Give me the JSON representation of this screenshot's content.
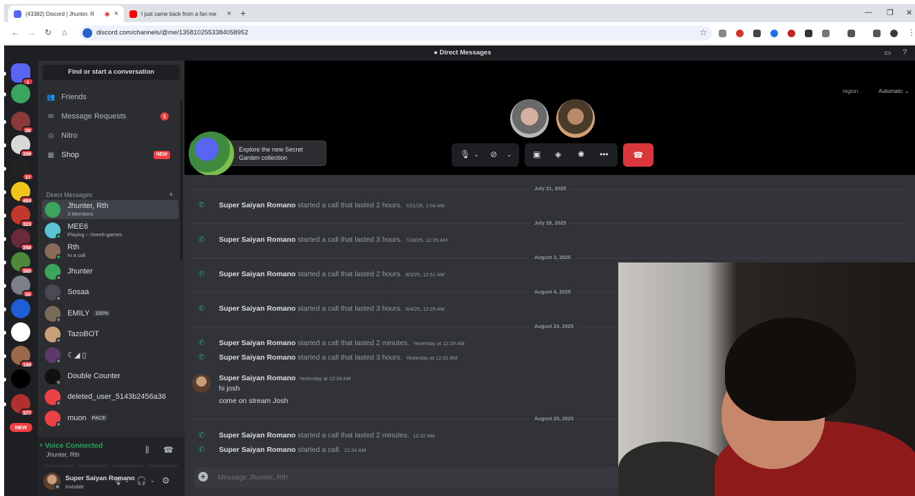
{
  "browser": {
    "tabs": [
      {
        "title": "(43382) Discord | Jhunter, R",
        "active": true,
        "color": "#5865f2"
      },
      {
        "title": "I just came back from a fan me",
        "active": false,
        "color": "#ff0000"
      }
    ],
    "url": "discord.com/channels/@me/1358102553384058952"
  },
  "app": {
    "title": "Direct Messages",
    "servers": [
      {
        "badge": "1",
        "color": "#5865f2"
      },
      {
        "badge": "",
        "color": "#3ba55d"
      },
      {
        "badge": "26",
        "color": "#8b3a3a"
      },
      {
        "badge": "208",
        "color": "#d8d8d8"
      },
      {
        "badge": "17",
        "color": "#222222"
      },
      {
        "badge": "450",
        "color": "#f0c419"
      },
      {
        "badge": "323",
        "color": "#c0392b"
      },
      {
        "badge": "258",
        "color": "#6b2a3a"
      },
      {
        "badge": "385",
        "color": "#4c8a3a"
      },
      {
        "badge": "56",
        "color": "#7a7f8a"
      },
      {
        "badge": "",
        "color": "#1e5fd6"
      },
      {
        "badge": "",
        "color": "#ffffff"
      },
      {
        "badge": "189",
        "color": "#9a6a4a"
      },
      {
        "badge": "",
        "color": "#000000"
      },
      {
        "badge": "377",
        "color": "#b03030"
      }
    ],
    "new_label": "NEW",
    "search_placeholder": "Find or start a conversation",
    "nav": [
      {
        "label": "Friends",
        "icon": "friends-icon"
      },
      {
        "label": "Message Requests",
        "icon": "mail-icon",
        "badge": "1"
      },
      {
        "label": "Nitro",
        "icon": "nitro-icon"
      },
      {
        "label": "Shop",
        "icon": "shop-icon",
        "tag": "NEW"
      }
    ],
    "dm_header": "Direct Messages",
    "dms": [
      {
        "name": "Jhunter, Rth",
        "sub": "3 Members",
        "color": "#3ba55d",
        "status": "",
        "selected": true
      },
      {
        "name": "MEE6",
        "sub": "Playing ⌐ /mee6-games",
        "color": "#5cc2d6",
        "status": "#23a55a"
      },
      {
        "name": "Rth",
        "sub": "In a call",
        "color": "#8a6a5a",
        "status": "#23a55a"
      },
      {
        "name": "Jhunter",
        "sub": "",
        "color": "#3ba55d",
        "status": "#80848e"
      },
      {
        "name": "Sosaa",
        "sub": "",
        "color": "#4a4a55",
        "status": "#80848e"
      },
      {
        "name": "EMILY",
        "sub": "",
        "tag": "100%",
        "color": "#7a6a5a",
        "status": "#80848e"
      },
      {
        "name": "TazoBOT",
        "sub": "",
        "color": "#c9a07a",
        "status": "#80848e"
      },
      {
        "name": "☾◢ ▯",
        "sub": "",
        "color": "#5a3a6a",
        "status": "#80848e"
      },
      {
        "name": "Double Counter",
        "sub": "",
        "color": "#111111",
        "status": "#80848e"
      },
      {
        "name": "deleted_user_5143b2456a36",
        "sub": "",
        "color": "#ed4245",
        "status": "#80848e"
      },
      {
        "name": "muon",
        "sub": "",
        "tag": "PACE",
        "color": "#ed4245",
        "status": "#80848e"
      }
    ],
    "voice": {
      "status": "Voice Connected",
      "channel": "Jhunter, Rth"
    },
    "user": {
      "name": "Super Saiyan Romano",
      "status": "Invisible"
    },
    "call": {
      "region_label": "region",
      "region_value": "Automatic"
    },
    "promo": "Explore the new Secret Garden collection",
    "composer_placeholder": "Message Jhunter, Rth",
    "messages": {
      "d1": "July 21, 2025",
      "m1": {
        "author": "Super Saiyan Romano",
        "text": "started a call that lasted 2 hours.",
        "ts": "7/21/25, 1:04 AM"
      },
      "d2": "July 28, 2025",
      "m2": {
        "author": "Super Saiyan Romano",
        "text": "started a call that lasted 3 hours.",
        "ts": "7/28/25, 12:35 AM"
      },
      "d3": "August 3, 2025",
      "m3": {
        "author": "Super Saiyan Romano",
        "text": "started a call that lasted 2 hours.",
        "ts": "8/3/25, 12:51 AM"
      },
      "d4": "August 4, 2025",
      "m4": {
        "author": "Super Saiyan Romano",
        "text": "started a call that lasted 3 hours.",
        "ts": "8/4/25, 12:29 AM"
      },
      "d5": "August 24, 2025",
      "m5": {
        "author": "Super Saiyan Romano",
        "text": "started a call that lasted 2 minutes.",
        "ts": "Yesterday at 12:29 AM"
      },
      "m6": {
        "author": "Super Saiyan Romano",
        "text": "started a call that lasted 3 hours.",
        "ts": "Yesterday at 12:31 AM"
      },
      "chat": {
        "author": "Super Saiyan Romano",
        "ts": "Yesterday at 12:34 AM",
        "line1": "hi josh",
        "line2": "come on stream Josh"
      },
      "d6": "August 25, 2025",
      "m7": {
        "author": "Super Saiyan Romano",
        "text": "started a call that lasted 2 minutes.",
        "ts": "12:32 AM"
      },
      "m8": {
        "author": "Super Saiyan Romano",
        "text": "started a call.",
        "ts": "12:34 AM"
      }
    }
  }
}
